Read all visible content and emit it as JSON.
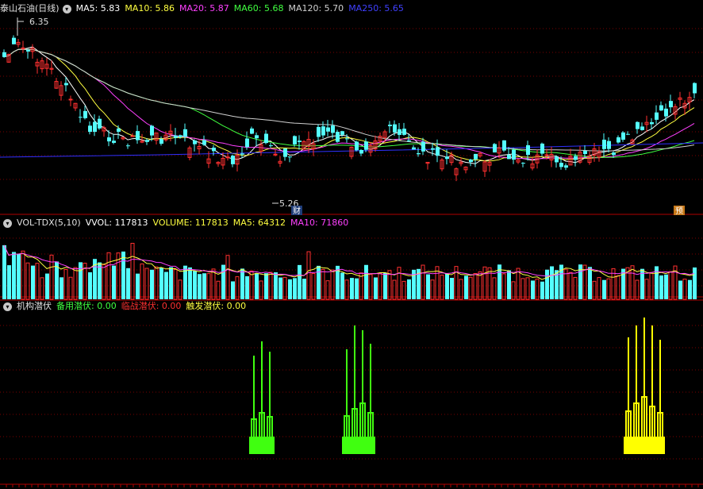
{
  "main_pane": {
    "title": "泰山石油(日线)",
    "ma": [
      {
        "label": "MA5: 5.83",
        "color": "#ffffff"
      },
      {
        "label": "MA10: 5.86",
        "color": "#ffff40"
      },
      {
        "label": "MA20: 5.87",
        "color": "#ff40ff"
      },
      {
        "label": "MA60: 5.68",
        "color": "#40ff40"
      },
      {
        "label": "MA120: 5.70",
        "color": "#d0d0d0"
      },
      {
        "label": "MA250: 5.65",
        "color": "#4040ff"
      }
    ],
    "high_label": "6.35",
    "low_label": "5.26",
    "marker_cai": "财",
    "marker_yu": "预"
  },
  "volume_pane": {
    "title": "VOL-TDX(5,10)",
    "items": [
      {
        "label": "VVOL: 117813",
        "color": "#ffffff"
      },
      {
        "label": "VOLUME: 117813",
        "color": "#ffff40"
      },
      {
        "label": "MA5: 64312",
        "color": "#ffff40"
      },
      {
        "label": "MA10: 71860",
        "color": "#ff40ff"
      }
    ]
  },
  "indicator_pane": {
    "title": "机构潜伏",
    "items": [
      {
        "label": "备用潜伏: 0.00",
        "color": "#40ff40"
      },
      {
        "label": "临战潜伏: 0.00",
        "color": "#ff3030"
      },
      {
        "label": "触发潜伏: 0.00",
        "color": "#ffff40"
      }
    ]
  },
  "colors": {
    "up": "#ff3030",
    "down": "#54ffff",
    "grid": "#7a0000",
    "separator": "#b00000",
    "green_signal": "#40ff10",
    "yellow_signal": "#ffff00"
  }
}
